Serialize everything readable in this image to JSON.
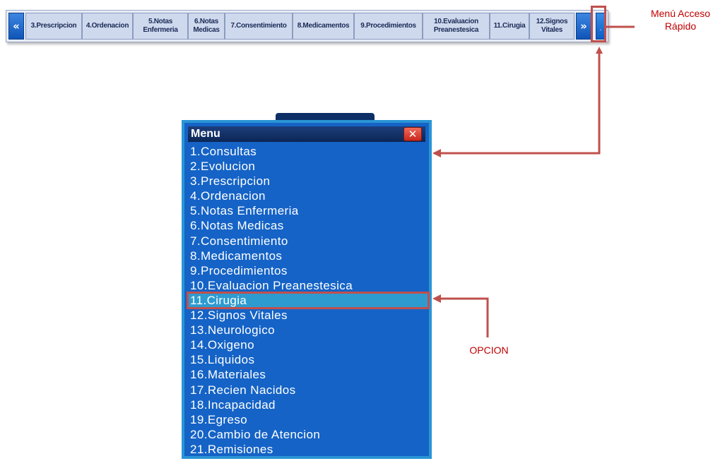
{
  "tabbar": {
    "prev_label": "«",
    "next_label": "»",
    "quick_menu_label": ".",
    "tabs": [
      {
        "label": "3.Prescripcion"
      },
      {
        "label": "4.Ordenacion"
      },
      {
        "label": "5.Notas\nEnfermeria"
      },
      {
        "label": "6.Notas\nMedicas"
      },
      {
        "label": "7.Consentimiento"
      },
      {
        "label": "8.Medicamentos"
      },
      {
        "label": "9.Procedimientos"
      },
      {
        "label": "10.Evaluacion\nPreanestesica"
      },
      {
        "label": "11.Cirugia"
      },
      {
        "label": "12.Signos\nVitales"
      }
    ]
  },
  "annotations": {
    "quick_access_label": "Menú Acceso\nRápido",
    "option_label": "OPCION",
    "color": "#c0504d"
  },
  "menu": {
    "title": "Menu",
    "close_label": "✕",
    "selected_index": 10,
    "items": [
      {
        "label": "1.Consultas"
      },
      {
        "label": "2.Evolucion"
      },
      {
        "label": "3.Prescripcion"
      },
      {
        "label": "4.Ordenacion"
      },
      {
        "label": "5.Notas Enfermeria"
      },
      {
        "label": "6.Notas Medicas"
      },
      {
        "label": "7.Consentimiento"
      },
      {
        "label": "8.Medicamentos"
      },
      {
        "label": "9.Procedimientos"
      },
      {
        "label": "10.Evaluacion Preanestesica"
      },
      {
        "label": "11.Cirugia"
      },
      {
        "label": "12.Signos Vitales"
      },
      {
        "label": "13.Neurologico"
      },
      {
        "label": "14.Oxigeno"
      },
      {
        "label": "15.Liquidos"
      },
      {
        "label": "16.Materiales"
      },
      {
        "label": "17.Recien Nacidos"
      },
      {
        "label": "18.Incapacidad"
      },
      {
        "label": "19.Egreso"
      },
      {
        "label": "20.Cambio de Atencion"
      },
      {
        "label": "21.Remisiones"
      }
    ]
  },
  "colors": {
    "menu_bg": "#1563c6",
    "menu_border": "#2a95d6",
    "menu_header": "#0c2654",
    "tab_bg": "#cfd9ee",
    "nav_button": "#0f55b8",
    "annotation_red": "#c0504d"
  }
}
